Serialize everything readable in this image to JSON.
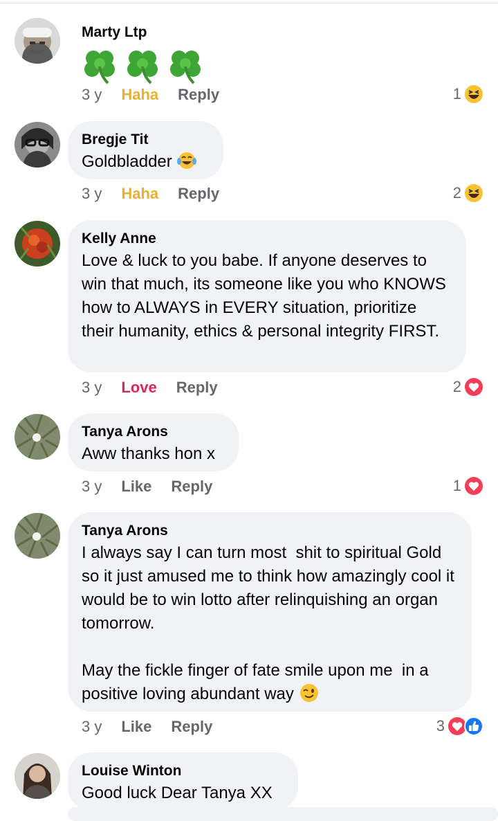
{
  "comments": [
    {
      "name": "Marty Ltp",
      "text": "",
      "time": "3 y",
      "reaction_label": "Haha",
      "reply_label": "Reply",
      "reaction_count": "1",
      "reaction_types": [
        "haha-icon"
      ]
    },
    {
      "name": "Bregje Tit",
      "text": "Goldbladder",
      "time": "3 y",
      "reaction_label": "Haha",
      "reply_label": "Reply",
      "reaction_count": "2",
      "reaction_types": [
        "haha-icon"
      ]
    },
    {
      "name": "Kelly Anne",
      "text": "Love & luck to you babe. If anyone deserves to win that much, its someone like you who KNOWS how to ALWAYS in EVERY situation, prioritize their humanity, ethics & personal integrity FIRST.",
      "time": "3 y",
      "reaction_label": "Love",
      "reply_label": "Reply",
      "reaction_count": "2",
      "reaction_types": [
        "love-icon"
      ]
    },
    {
      "name": "Tanya Arons",
      "text": "Aww thanks hon x",
      "time": "3 y",
      "reaction_label": "Like",
      "reply_label": "Reply",
      "reaction_count": "1",
      "reaction_types": [
        "love-icon"
      ]
    },
    {
      "name": "Tanya Arons",
      "text_line1": "I always say I can turn most  shit to spiritual Gold so it just amused me to think how amazingly cool it would be to win lotto after relinquishing an organ tomorrow.",
      "text_line2": "May the fickle finger of fate smile upon me  in a positive loving abundant way",
      "time": "3 y",
      "reaction_label": "Like",
      "reply_label": "Reply",
      "reaction_count": "3",
      "reaction_types": [
        "love-icon",
        "like-icon"
      ]
    },
    {
      "name": "Louise Winton",
      "text": "Good luck Dear Tanya XX"
    }
  ],
  "colors": {
    "haha": "#e5b334",
    "love": "#e0245e",
    "like": "#1877f2",
    "bubble": "#f0f2f5",
    "meta": "#65676b"
  }
}
